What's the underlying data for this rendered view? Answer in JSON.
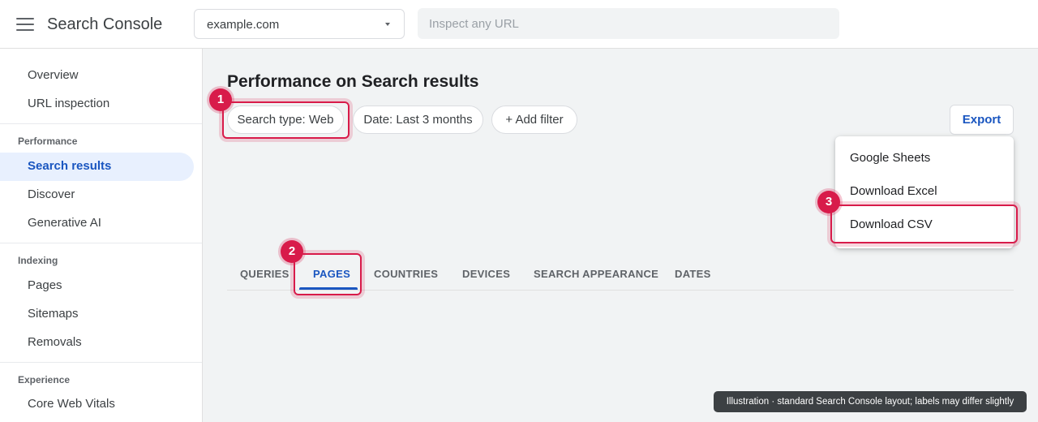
{
  "app": {
    "title": "Search Console"
  },
  "topbar": {
    "menu_icon": "hamburger-menu-icon",
    "property": "example.com",
    "inspect_placeholder": "Inspect any URL"
  },
  "sidebar": {
    "items_top": [
      "Overview",
      "URL inspection"
    ],
    "performance": {
      "title": "Performance",
      "items": [
        "Search results",
        "Discover",
        "Generative AI"
      ],
      "active": "Search results"
    },
    "indexing": {
      "title": "Indexing",
      "items": [
        "Pages",
        "Sitemaps",
        "Removals"
      ]
    },
    "experience": {
      "title": "Experience",
      "items": [
        "Core Web Vitals"
      ]
    }
  },
  "main": {
    "title": "Performance on Search results",
    "filters": [
      "Search type: Web",
      "Date: Last 3 months",
      "+ Add filter"
    ],
    "export_label": "Export",
    "export_menu": [
      "Google Sheets",
      "Download Excel",
      "Download CSV"
    ],
    "tabs": [
      "QUERIES",
      "PAGES",
      "COUNTRIES",
      "DEVICES",
      "SEARCH APPEARANCE",
      "DATES"
    ],
    "active_tab": "PAGES"
  },
  "annotations": {
    "steps": [
      "1",
      "2",
      "3"
    ],
    "color": "#d81b4a"
  },
  "footnote": "Illustration · standard Search Console layout; labels may differ slightly",
  "colors": {
    "accent": "#1a56c0",
    "active_nav_bg": "#e8f0fe",
    "highlight": "#d81b4a"
  }
}
